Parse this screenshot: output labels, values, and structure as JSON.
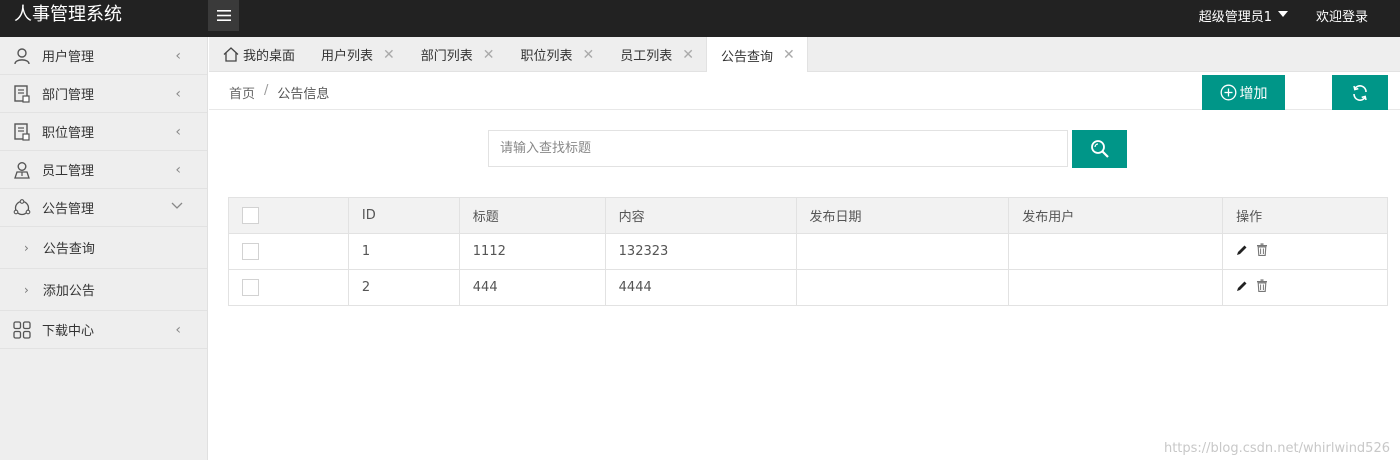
{
  "app": {
    "title": "人事管理系统"
  },
  "topbar": {
    "user_name": "超级管理员1",
    "logout_label": "欢迎登录"
  },
  "sidebar": {
    "items": [
      {
        "label": "用户管理",
        "icon": "user-icon"
      },
      {
        "label": "部门管理",
        "icon": "document-icon"
      },
      {
        "label": "职位管理",
        "icon": "document-icon"
      },
      {
        "label": "员工管理",
        "icon": "employee-icon"
      },
      {
        "label": "公告管理",
        "icon": "notice-icon",
        "expanded": true
      },
      {
        "label": "下载中心",
        "icon": "grid-icon"
      }
    ],
    "subitems": [
      {
        "label": "公告查询"
      },
      {
        "label": "添加公告"
      }
    ]
  },
  "tabs": [
    {
      "label": "我的桌面",
      "closable": false
    },
    {
      "label": "用户列表",
      "closable": true
    },
    {
      "label": "部门列表",
      "closable": true
    },
    {
      "label": "职位列表",
      "closable": true
    },
    {
      "label": "员工列表",
      "closable": true
    },
    {
      "label": "公告查询",
      "closable": true,
      "active": true
    }
  ],
  "breadcrumb": {
    "home": "首页",
    "separator": "/",
    "current": "公告信息"
  },
  "toolbar": {
    "add_label": "增加"
  },
  "search": {
    "placeholder": "请输入查找标题",
    "value": ""
  },
  "table": {
    "headers": [
      "ID",
      "标题",
      "内容",
      "发布日期",
      "发布用户",
      "操作"
    ],
    "rows": [
      {
        "id": "1",
        "title": "1112",
        "content": "132323",
        "date": "",
        "user": ""
      },
      {
        "id": "2",
        "title": "444",
        "content": "4444",
        "date": "",
        "user": ""
      }
    ]
  },
  "watermark": "https://blog.csdn.net/whirlwind526",
  "colors": {
    "accent": "#009688",
    "topbar": "#222222",
    "sidebar": "#eeeeee"
  }
}
